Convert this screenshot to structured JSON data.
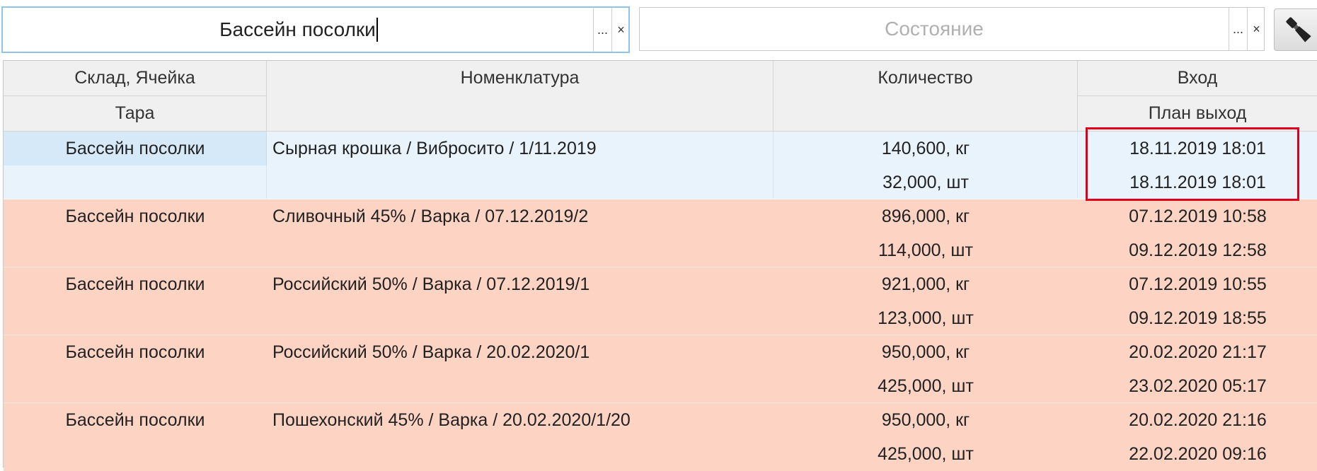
{
  "filters": {
    "cell_value": "Бассейн посолки",
    "state_placeholder": "Состояние",
    "ellipsis": "...",
    "clear": "×"
  },
  "colors": {
    "selected_row": "#e8f3fb",
    "selected_cell": "#d6e9f8",
    "warning_row": "#fdd3c3",
    "highlight_box": "#e0001b"
  },
  "table": {
    "headers": {
      "col1_top": "Склад, Ячейка",
      "col1_bottom": "Тара",
      "col2": "Номенклатура",
      "col3": "Количество",
      "col4_top": "Вход",
      "col4_bottom": "План выход"
    },
    "rows": [
      {
        "cell": "Бассейн посолки",
        "item": "Сырная крошка / Вибросито / 1/11.2019",
        "qty_kg": "140,600, кг",
        "qty_pcs": "32,000, шт",
        "in": "18.11.2019 18:01",
        "out": "18.11.2019 18:01",
        "state": "selected"
      },
      {
        "cell": "Бассейн посолки",
        "item": "Сливочный 45% / Варка / 07.12.2019/2",
        "qty_kg": "896,000, кг",
        "qty_pcs": "114,000, шт",
        "in": "07.12.2019 10:58",
        "out": "09.12.2019 12:58",
        "state": "warning"
      },
      {
        "cell": "Бассейн посолки",
        "item": "Российский 50% / Варка / 07.12.2019/1",
        "qty_kg": "921,000, кг",
        "qty_pcs": "123,000, шт",
        "in": "07.12.2019 10:55",
        "out": "09.12.2019 18:55",
        "state": "warning"
      },
      {
        "cell": "Бассейн посолки",
        "item": "Российский 50% / Варка / 20.02.2020/1",
        "qty_kg": "950,000, кг",
        "qty_pcs": "425,000, шт",
        "in": "20.02.2020 21:17",
        "out": "23.02.2020 05:17",
        "state": "warning"
      },
      {
        "cell": "Бассейн посолки",
        "item": "Пошехонский 45% / Варка / 20.02.2020/1/20",
        "qty_kg": "950,000, кг",
        "qty_pcs": "425,000, шт",
        "in": "20.02.2020 21:16",
        "out": "22.02.2020 09:16",
        "state": "warning"
      }
    ]
  }
}
